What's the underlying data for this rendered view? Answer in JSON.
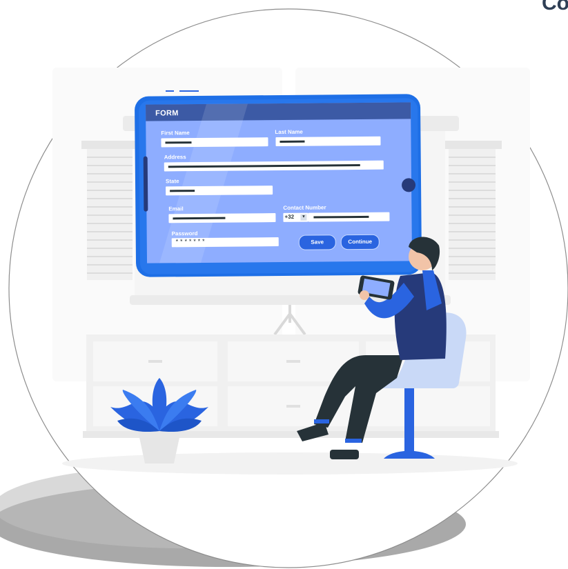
{
  "corner_text": "Co",
  "form": {
    "title": "FORM",
    "first_name_label": "First Name",
    "last_name_label": "Last Name",
    "address_label": "Address",
    "state_label": "State",
    "email_label": "Email",
    "contact_label": "Contact Number",
    "country_code": "+32",
    "dropdown_arrow": "▼",
    "password_label": "Password",
    "password_value": "*******",
    "save_label": "Save",
    "continue_label": "Continue"
  },
  "colors": {
    "primary": "#2a64e0",
    "screen": "#8eadff",
    "header": "#3c5aa5",
    "bg_light": "#f2f2f2",
    "dark": "#263238"
  }
}
